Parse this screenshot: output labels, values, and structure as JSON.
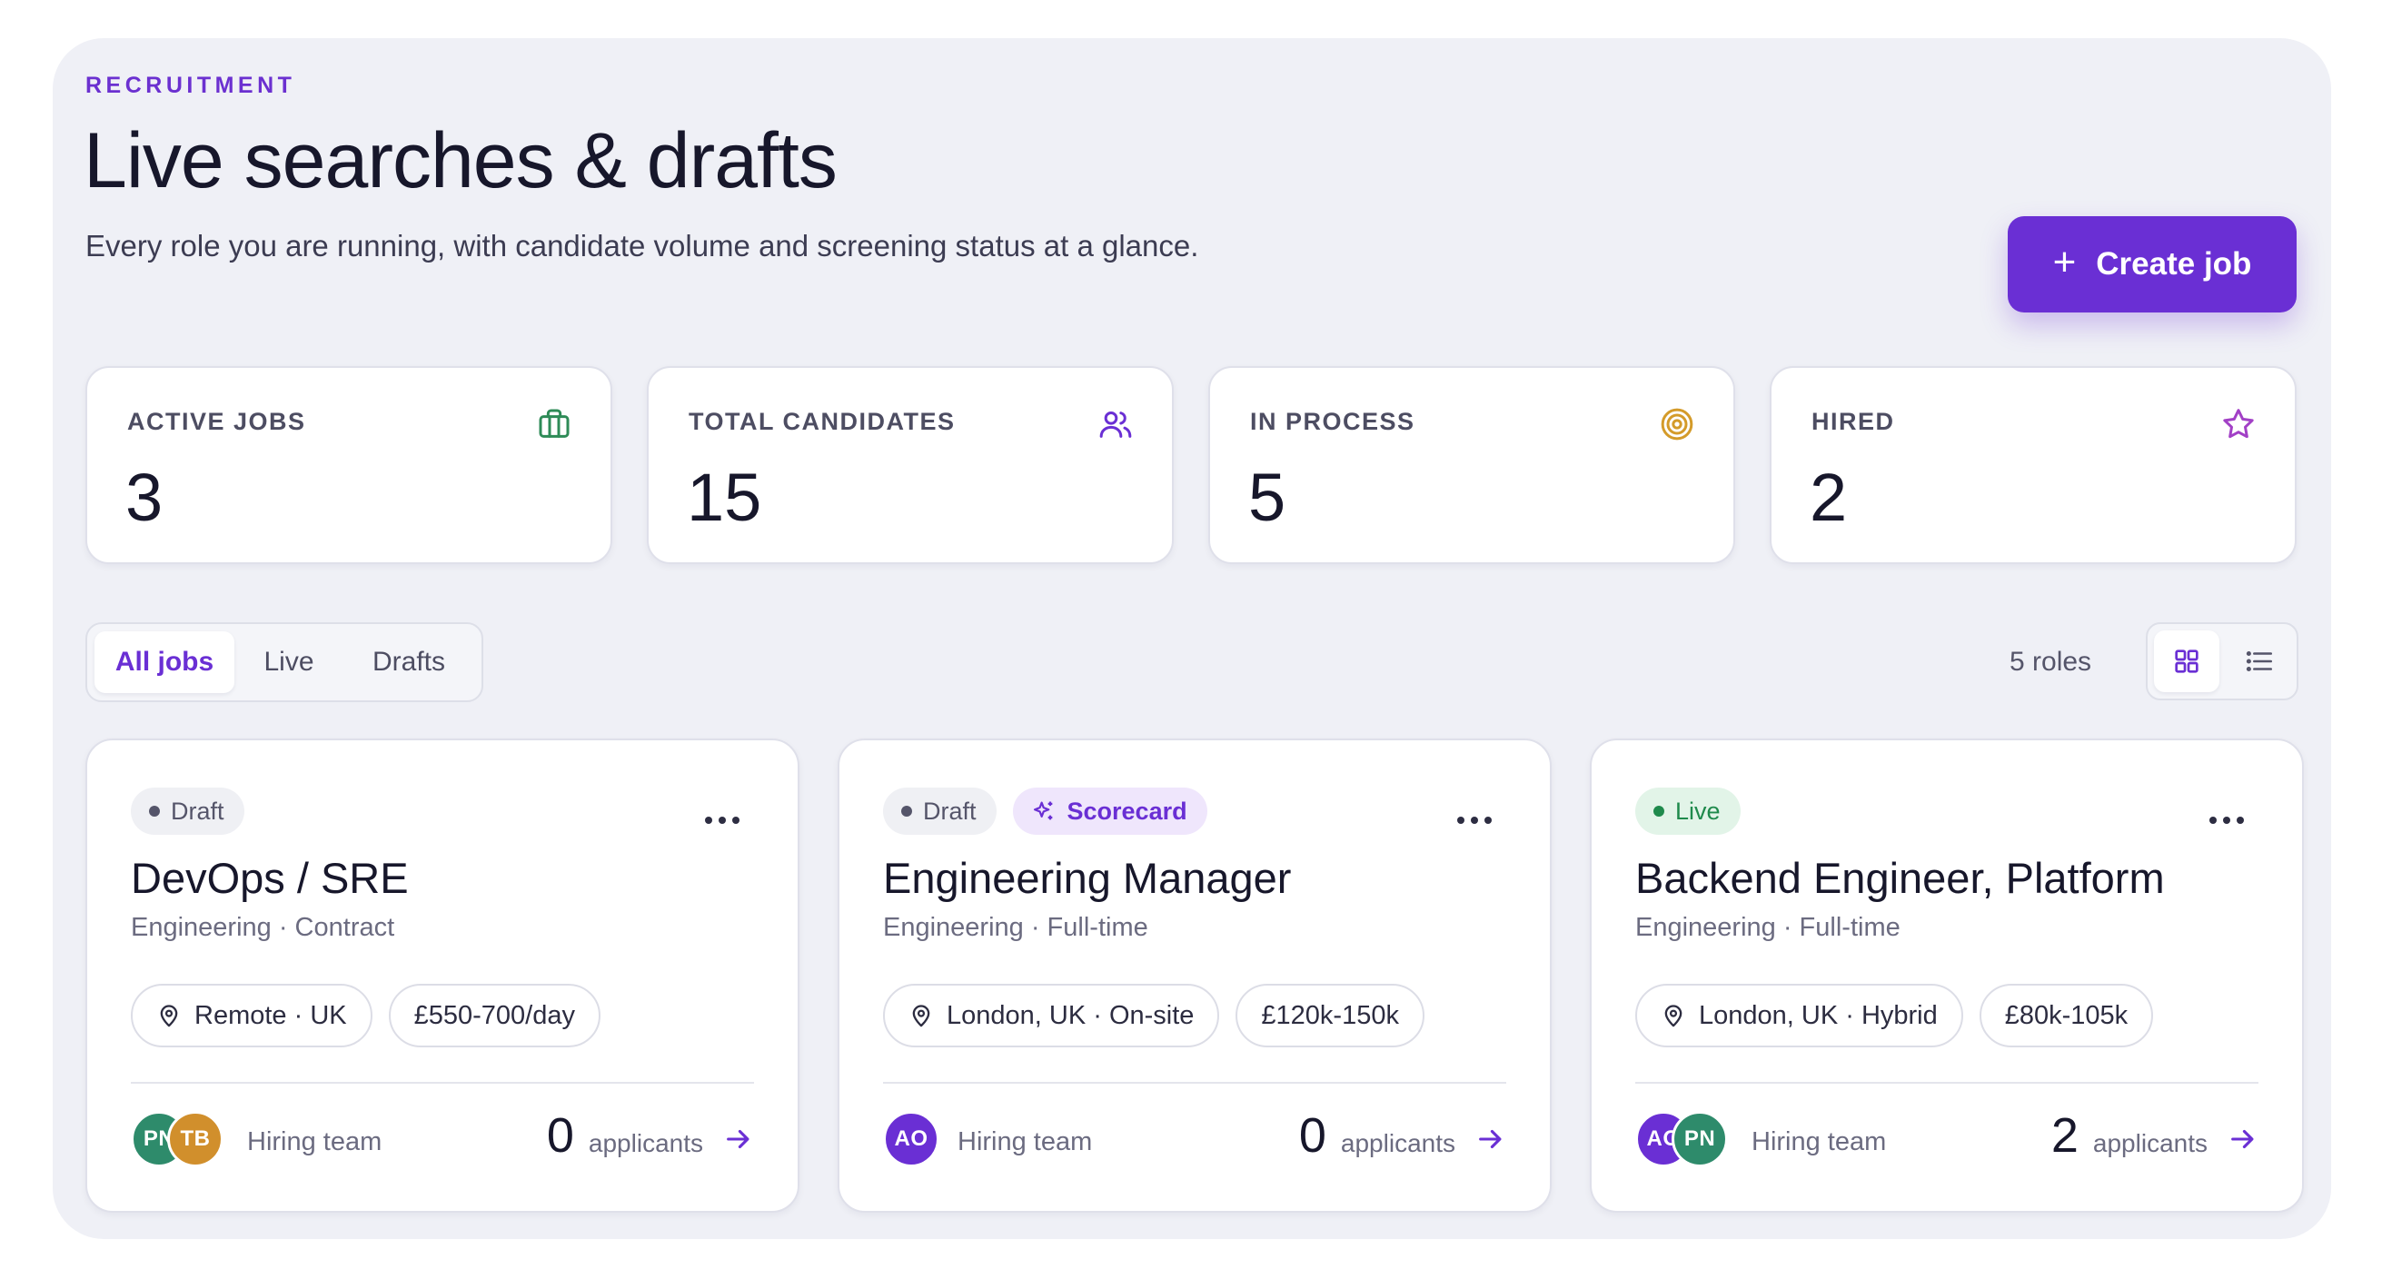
{
  "header": {
    "eyebrow": "RECRUITMENT",
    "title": "Live searches & drafts",
    "subtitle": "Every role you are running, with candidate volume and screening status at a glance."
  },
  "actions": {
    "create_label": "Create job"
  },
  "stats": [
    {
      "label": "ACTIVE JOBS",
      "value": "3",
      "icon": "briefcase-icon",
      "color": "#2e8b57"
    },
    {
      "label": "TOTAL CANDIDATES",
      "value": "15",
      "icon": "users-icon",
      "color": "#6a2fd4"
    },
    {
      "label": "IN PROCESS",
      "value": "5",
      "icon": "target-icon",
      "color": "#d49b2a"
    },
    {
      "label": "HIRED",
      "value": "2",
      "icon": "star-icon",
      "color": "#a240c6"
    }
  ],
  "filters": {
    "tabs": [
      "All jobs",
      "Live",
      "Drafts"
    ],
    "active": "All jobs",
    "count": "5 roles",
    "view": "grid"
  },
  "jobs": [
    {
      "status": "Draft",
      "title": "DevOps / SRE",
      "meta": "Engineering · Contract",
      "location": "Remote · UK",
      "pay": "£550-700/day",
      "avatars": [
        "PN",
        "TB"
      ],
      "team_label": "Hiring team",
      "applicants": "0",
      "applicants_label": "applicants"
    },
    {
      "status": "Draft",
      "extra_badge": "Scorecard",
      "title": "Engineering Manager",
      "meta": "Engineering · Full-time",
      "location": "London, UK · On-site",
      "pay": "£120k-150k",
      "avatars": [
        "AO"
      ],
      "team_label": "Hiring team",
      "applicants": "0",
      "applicants_label": "applicants"
    },
    {
      "status": "Live",
      "title": "Backend Engineer, Platform",
      "meta": "Engineering · Full-time",
      "location": "London, UK · Hybrid",
      "pay": "£80k-105k",
      "avatars": [
        "AO",
        "PN"
      ],
      "team_label": "Hiring team",
      "applicants": "2",
      "applicants_label": "applicants"
    }
  ],
  "colors": {
    "accent": "#6a2fd4",
    "live": "#1f8a4c",
    "panel": "#eff0f6"
  }
}
